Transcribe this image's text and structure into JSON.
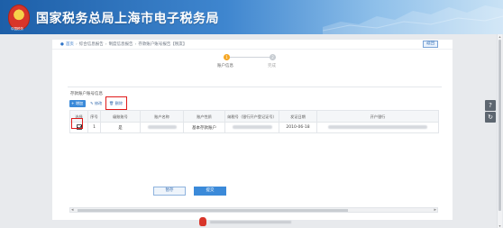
{
  "header": {
    "title": "国家税务总局上海市电子税务局",
    "emblem_text": "中国税务"
  },
  "breadcrumb": {
    "items": [
      "首页",
      "综合信息报告",
      "制度信息报告",
      "存款账户账号报告【税友】"
    ]
  },
  "return_button": "返回",
  "steps": [
    {
      "num": "1",
      "label": "账户信息"
    },
    {
      "num": "2",
      "label": "完成"
    }
  ],
  "panel": {
    "title": "存款账户账号信息"
  },
  "toolbar": {
    "add": "+ 增加",
    "edit": "✎ 修改",
    "delete": "🗑 删除"
  },
  "table": {
    "headers": [
      "选择",
      "序号",
      "级账账号",
      "账户名称",
      "账户性质",
      "纳税号（银行开户登记证号）",
      "发证日期",
      "开户银行"
    ],
    "rows": [
      {
        "selected": true,
        "seq": "1",
        "flag": "是",
        "account_name": "",
        "nature": "基本存款账户",
        "tax_no": "",
        "date": "2010-06-18",
        "bank": ""
      }
    ]
  },
  "actions": {
    "temp_save": "暂存",
    "submit": "提交"
  },
  "side_widgets": [
    "?",
    "↻"
  ],
  "colors": {
    "header_blue": "#1d5fa8",
    "primary": "#3b8ad9",
    "step_active": "#f5a623",
    "highlight": "#e01b1b"
  }
}
